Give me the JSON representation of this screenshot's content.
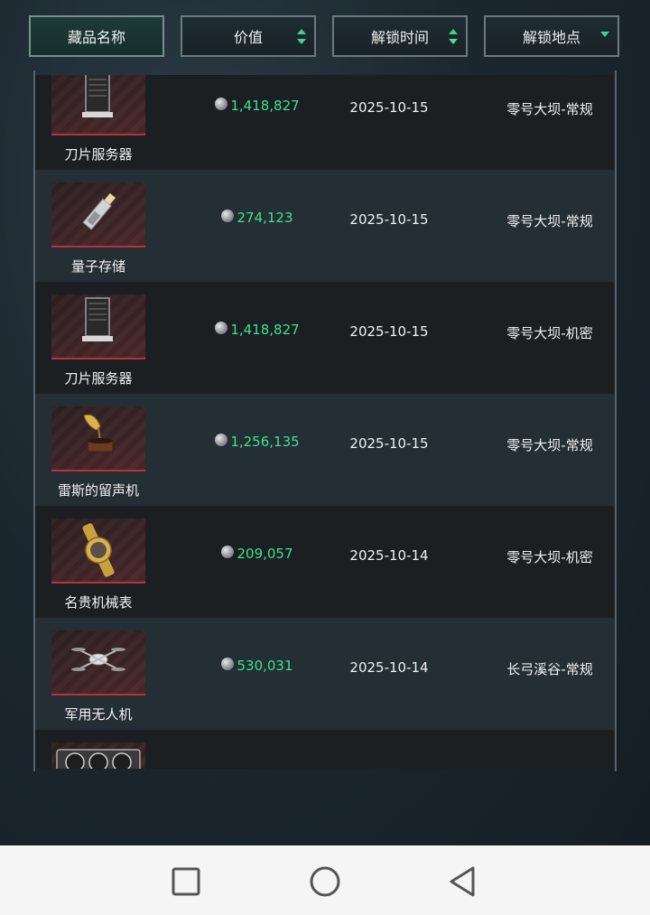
{
  "header": {
    "name_label": "藏品名称",
    "value_label": "价值",
    "time_label": "解锁时间",
    "location_label": "解锁地点"
  },
  "colors": {
    "value_text": "#3ee08e",
    "sort_arrow": "#3fd28a",
    "thumb_underline": "#b8323a"
  },
  "items": [
    {
      "name": "刀片服务器",
      "value": "1,418,827",
      "date": "2025-10-15",
      "location": "零号大坝-常规",
      "icon": "server-icon"
    },
    {
      "name": "量子存储",
      "value": "274,123",
      "date": "2025-10-15",
      "location": "零号大坝-常规",
      "icon": "usb-drive-icon"
    },
    {
      "name": "刀片服务器",
      "value": "1,418,827",
      "date": "2025-10-15",
      "location": "零号大坝-机密",
      "icon": "server-icon"
    },
    {
      "name": "雷斯的留声机",
      "value": "1,256,135",
      "date": "2025-10-15",
      "location": "零号大坝-常规",
      "icon": "gramophone-icon"
    },
    {
      "name": "名贵机械表",
      "value": "209,057",
      "date": "2025-10-14",
      "location": "零号大坝-机密",
      "icon": "watch-icon"
    },
    {
      "name": "军用无人机",
      "value": "530,031",
      "date": "2025-10-14",
      "location": "长弓溪谷-常规",
      "icon": "drone-icon"
    },
    {
      "name": "",
      "value": "",
      "date": "",
      "location": "",
      "icon": "graphics-card-icon"
    }
  ],
  "navbar": {
    "recent": "recent-apps-icon",
    "home": "home-icon",
    "back": "back-icon"
  }
}
